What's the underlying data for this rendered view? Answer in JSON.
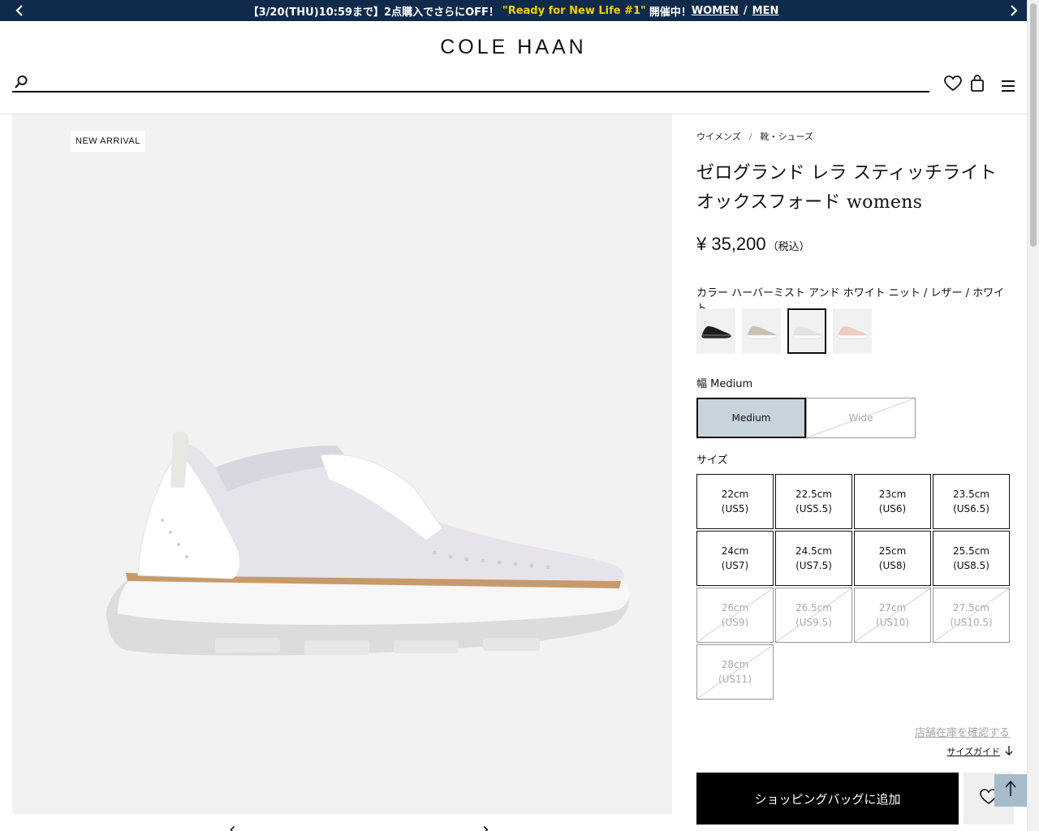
{
  "announcement": {
    "prefix": "【3/20(THU)10:59まで】2点購入でさらにOFF！",
    "highlight": "\"Ready for New Life #1\"",
    "suffix": "開催中！",
    "link_women": "WOMEN",
    "separator": "/",
    "link_men": "MEN"
  },
  "header": {
    "logo": "COLE HAAN",
    "search_placeholder": ""
  },
  "product_image": {
    "badge": "NEW ARRIVAL"
  },
  "breadcrumb": {
    "items": [
      "ウイメンズ",
      "靴・シューズ"
    ],
    "separator": "/"
  },
  "product": {
    "title": "ゼログランド レラ スティッチライト オックスフォード womens",
    "price": "¥ 35,200",
    "tax_note": "（税込）",
    "color_label": "カラー ハーバーミスト アンド ホワイト ニット / レザー / ホワイト",
    "swatches": [
      {
        "name": "black",
        "color": "#1e1e1e",
        "sole": "#2a2a2a"
      },
      {
        "name": "taupe",
        "color": "#cbbfae",
        "sole": "#ffffff"
      },
      {
        "name": "white",
        "color": "#e2e2e6",
        "sole": "#ffffff"
      },
      {
        "name": "pink",
        "color": "#f2cbc3",
        "sole": "#ffffff"
      }
    ],
    "width_label": "幅 Medium",
    "widths": [
      {
        "label": "Medium",
        "state": "selected"
      },
      {
        "label": "Wide",
        "state": "disabled"
      }
    ],
    "size_label": "サイズ",
    "sizes": [
      {
        "cm": "22cm",
        "us": "(US5)",
        "available": true
      },
      {
        "cm": "22.5cm",
        "us": "(US5.5)",
        "available": true
      },
      {
        "cm": "23cm",
        "us": "(US6)",
        "available": true
      },
      {
        "cm": "23.5cm",
        "us": "(US6.5)",
        "available": true
      },
      {
        "cm": "24cm",
        "us": "(US7)",
        "available": true
      },
      {
        "cm": "24.5cm",
        "us": "(US7.5)",
        "available": true
      },
      {
        "cm": "25cm",
        "us": "(US8)",
        "available": true
      },
      {
        "cm": "25.5cm",
        "us": "(US8.5)",
        "available": true
      },
      {
        "cm": "26cm",
        "us": "(US9)",
        "available": false
      },
      {
        "cm": "26.5cm",
        "us": "(US9.5)",
        "available": false
      },
      {
        "cm": "27cm",
        "us": "(US10)",
        "available": false
      },
      {
        "cm": "27.5cm",
        "us": "(US10.5)",
        "available": false
      },
      {
        "cm": "28cm",
        "us": "(US11)",
        "available": false
      }
    ],
    "store_stock_link": "店舗在庫を確認する",
    "size_guide_link": "サイズガイド",
    "add_to_bag": "ショッピングバッグに追加"
  },
  "colors": {
    "announce_bg": "#0f2a4a",
    "highlight": "#f5d000",
    "selected_width_bg": "#c8d4dc",
    "back_to_top_bg": "#a6bccb"
  }
}
